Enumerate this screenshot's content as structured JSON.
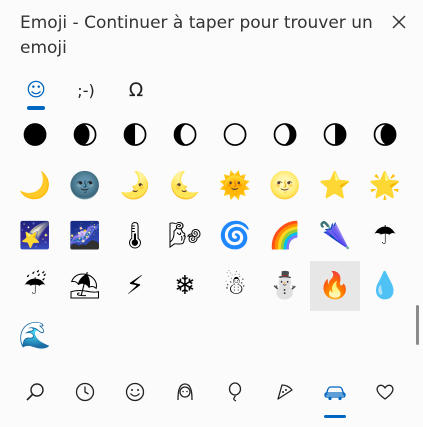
{
  "header": {
    "title": "Emoji - Continuer à taper pour trouver un emoji"
  },
  "close": {
    "label": "✕"
  },
  "tabs": [
    {
      "icon": "emoji-smiley-icon",
      "label": "☺",
      "active": true
    },
    {
      "icon": "kaomoji-icon",
      "label": ";-)",
      "active": false
    },
    {
      "icon": "omega-symbol-icon",
      "label": "Ω",
      "active": false
    }
  ],
  "emoji_rows": [
    [
      "🌑",
      "🌒",
      "🌓",
      "🌔",
      "🌕",
      "🌖",
      "🌗",
      "🌘"
    ],
    [
      "🌙",
      "🌚",
      "🌛",
      "🌜",
      "🌞",
      "🌝",
      "⭐",
      "🌟"
    ],
    [
      "🌠",
      "🌌",
      "🌡",
      "🌬",
      "🌀",
      "🌈",
      "🌂",
      "☂"
    ],
    [
      "☔",
      "⛱",
      "⚡",
      "❄",
      "☃",
      "⛄",
      "🔥",
      "💧"
    ],
    [
      "🌊"
    ]
  ],
  "selected": {
    "row": 3,
    "col": 6
  },
  "categories": [
    {
      "icon": "search-icon",
      "active": false
    },
    {
      "icon": "recent-clock-icon",
      "active": false
    },
    {
      "icon": "smiley-face-icon",
      "active": false
    },
    {
      "icon": "people-icon",
      "active": false
    },
    {
      "icon": "celebration-balloon-icon",
      "active": false
    },
    {
      "icon": "food-pizza-icon",
      "active": false
    },
    {
      "icon": "travel-car-icon",
      "active": true
    },
    {
      "icon": "heart-symbols-icon",
      "active": false
    }
  ],
  "colors": {
    "accent": "#0067c0",
    "text": "#333333",
    "selected_bg": "#e7e7e7"
  }
}
